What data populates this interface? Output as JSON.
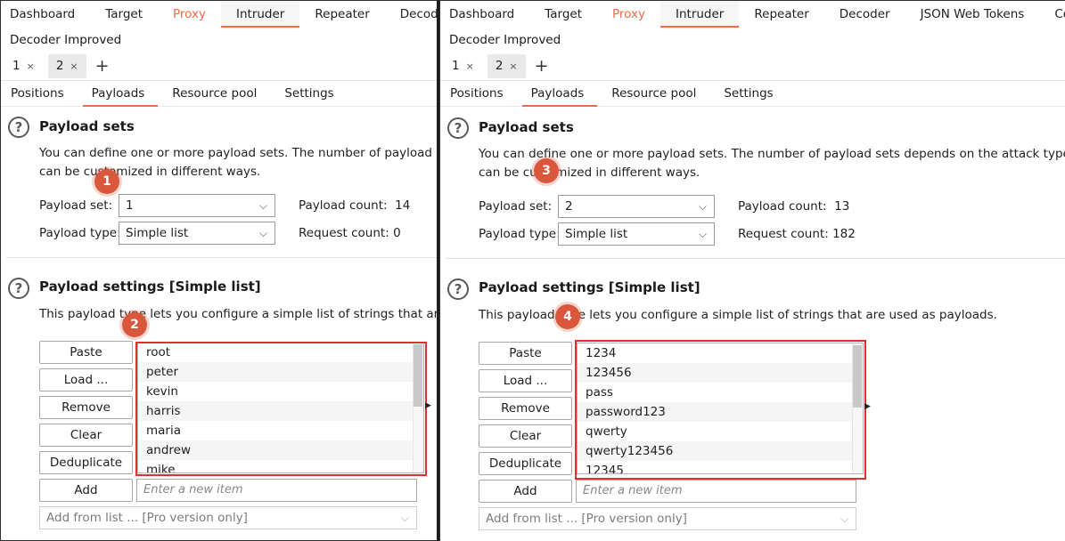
{
  "left": {
    "tool_tabs": [
      "Dashboard",
      "Target",
      "Proxy",
      "Intruder",
      "Repeater",
      "Decoder"
    ],
    "tool_tabs_row2": "Decoder Improved",
    "instance_tabs": [
      {
        "label": "1",
        "close": "×"
      },
      {
        "label": "2",
        "close": "×"
      }
    ],
    "add_tab": "+",
    "sub_tabs": [
      "Positions",
      "Payloads",
      "Resource pool",
      "Settings"
    ],
    "payload_sets": {
      "title": "Payload sets",
      "desc_line1": "You can define one or more payload sets. The number of payload sets",
      "desc_line2": "can be customized in different ways.",
      "set_label": "Payload set:",
      "set_value": "1",
      "type_label": "Payload type:",
      "type_value": "Simple list",
      "count_label": "Payload count:",
      "count_value": "14",
      "request_label": "Request count:",
      "request_value": "0"
    },
    "payload_settings": {
      "title": "Payload settings [Simple list]",
      "desc": "This payload type lets you configure a simple list of strings that are used as payloads.",
      "buttons": [
        "Paste",
        "Load ...",
        "Remove",
        "Clear",
        "Deduplicate",
        "Add"
      ],
      "items": [
        "root",
        "peter",
        "kevin",
        "harris",
        "maria",
        "andrew",
        "mike"
      ],
      "add_placeholder": "Enter a new item",
      "add_from_list": "Add from list ... [Pro version only]"
    },
    "badges": [
      "1",
      "2"
    ]
  },
  "right": {
    "tool_tabs": [
      "Dashboard",
      "Target",
      "Proxy",
      "Intruder",
      "Repeater",
      "Decoder",
      "JSON Web Tokens",
      "Coll"
    ],
    "tool_tabs_row2": "Decoder Improved",
    "instance_tabs": [
      {
        "label": "1",
        "close": "×"
      },
      {
        "label": "2",
        "close": "×"
      }
    ],
    "add_tab": "+",
    "sub_tabs": [
      "Positions",
      "Payloads",
      "Resource pool",
      "Settings"
    ],
    "payload_sets": {
      "title": "Payload sets",
      "desc_line1": "You can define one or more payload sets. The number of payload sets depends on the attack type defi",
      "desc_line2": "can be customized in different ways.",
      "set_label": "Payload set:",
      "set_value": "2",
      "type_label": "Payload type:",
      "type_value": "Simple list",
      "count_label": "Payload count:",
      "count_value": "13",
      "request_label": "Request count:",
      "request_value": "182"
    },
    "payload_settings": {
      "title": "Payload settings [Simple list]",
      "desc": "This payload type lets you configure a simple list of strings that are used as payloads.",
      "buttons": [
        "Paste",
        "Load ...",
        "Remove",
        "Clear",
        "Deduplicate",
        "Add"
      ],
      "items": [
        "1234",
        "123456",
        "pass",
        "password123",
        "qwerty",
        "qwerty123456",
        "12345"
      ],
      "add_placeholder": "Enter a new item",
      "add_from_list": "Add from list ... [Pro version only]"
    },
    "badges": [
      "3",
      "4"
    ]
  },
  "icons": {
    "help": "?",
    "chevron": "⌵",
    "resize": "▶"
  },
  "colors": {
    "accent": "#ee6b45",
    "badge": "#d9573c",
    "highlight": "#e03131"
  }
}
